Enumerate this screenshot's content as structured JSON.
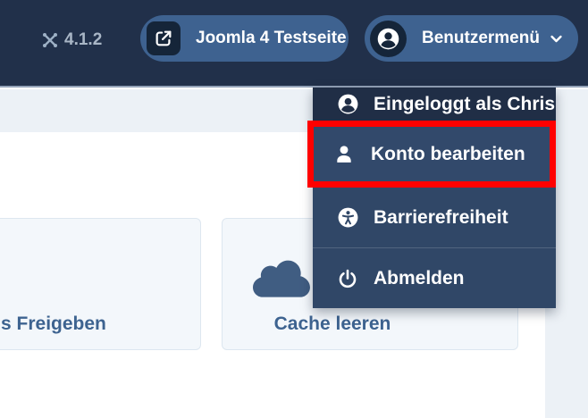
{
  "header": {
    "version": "4.1.2",
    "site_button": {
      "label": "Joomla 4 Testseite",
      "icon": "external-link-icon"
    },
    "user_menu_button": {
      "label": "Benutzermenü",
      "icon": "user-circle-icon",
      "chevron": "chevron-down-icon",
      "expanded": true
    }
  },
  "user_dropdown": {
    "items": [
      {
        "label": "Eingeloggt als Chris",
        "icon": "user-circle-icon",
        "type": "header"
      },
      {
        "label": "Konto bearbeiten",
        "icon": "user-icon",
        "highlighted": true
      },
      {
        "label": "Barrierefreiheit",
        "icon": "universal-access-icon"
      },
      {
        "label": "Abmelden",
        "icon": "power-icon"
      }
    ]
  },
  "quick_actions": [
    {
      "label_visible": "s Freigeben",
      "note": "partially off-screen tile"
    },
    {
      "label": "Cache leeren",
      "icon": "cloud-icon"
    }
  ],
  "annotation": {
    "shape": "red-rectangle",
    "color": "#ff0000",
    "target": "Konto bearbeiten"
  },
  "colors": {
    "header_bg": "#21304a",
    "pill_bg": "#3e6290",
    "pill_icon_bg": "#152539",
    "dropdown_bg": "#304767",
    "dropdown_header_bg": "#202e46",
    "highlight_item_bg": "#32496b",
    "annotation_red": "#ff0000",
    "page_bg": "#ecf1f6",
    "panel_bg": "#ffffff",
    "tile_bg": "#f3f7fb",
    "tile_border": "#dde7f0",
    "tile_text": "#3d6390",
    "cloud_icon": "#405d82",
    "version_text": "#a9b6c6"
  }
}
